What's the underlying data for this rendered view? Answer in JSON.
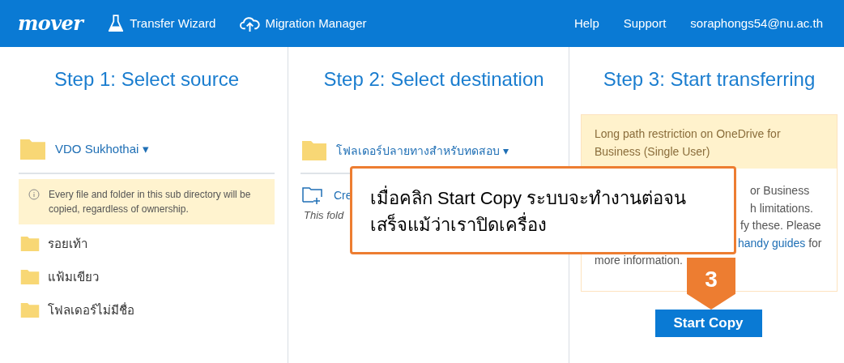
{
  "header": {
    "logo": "mover",
    "nav": [
      {
        "label": "Transfer Wizard"
      },
      {
        "label": "Migration Manager"
      }
    ],
    "links": [
      "Help",
      "Support",
      "soraphongs54@nu.ac.th"
    ]
  },
  "source": {
    "title": "Step 1: Select source",
    "folder": "VDO Sukhothai",
    "caret": "▾",
    "note": "Every file and folder in this sub directory will be copied, regardless of ownership.",
    "folders": [
      "รอยเท้า",
      "แฟ้มเขียว",
      "โฟลเดอร์ไม่มีชื่อ"
    ]
  },
  "destination": {
    "title": "Step 2: Select destination",
    "folder": "โฟลเดอร์ปลายทางสำหรับทดสอบ",
    "caret": "▾",
    "create_fragment": "Cre",
    "empty_fragment": "This fold"
  },
  "transfer": {
    "title": "Step 3: Start transferring",
    "warning_title": "Long path restriction on OneDrive for Business (Single User)",
    "body_fragments": [
      {
        "text": "or Business"
      },
      {
        "text": "h limitations."
      },
      {
        "text": "fy these. Please"
      },
      {
        "link": "handy guides",
        "text": " for"
      },
      {
        "text": "more information."
      }
    ],
    "button": "Start Copy"
  },
  "callout": {
    "text": "เมื่อคลิก Start Copy ระบบจะทำงานต่อจนเสร็จแม้ว่าเราปิดเครื่อง",
    "badge": "3"
  }
}
